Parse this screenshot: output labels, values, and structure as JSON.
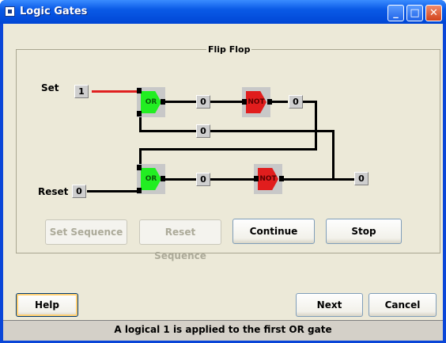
{
  "window": {
    "title": "Logic Gates",
    "minimize_glyph": "_",
    "maximize_glyph": "□",
    "close_glyph": "✕"
  },
  "frame": {
    "title": "Flip Flop"
  },
  "inputs": {
    "set_label": "Set",
    "set_value": "1",
    "reset_label": "Reset",
    "reset_value": "0"
  },
  "gates": {
    "or1": "OR",
    "not1": "NOT",
    "or2": "OR",
    "not2": "NOT"
  },
  "values": {
    "or1_out": "0",
    "not1_out": "0",
    "feedback": "0",
    "or2_out": "0",
    "output": "0"
  },
  "buttons": {
    "set_sequence": "Set Sequence",
    "reset_sequence": "Reset Sequence",
    "continue": "Continue",
    "stop": "Stop",
    "help": "Help",
    "next": "Next",
    "cancel": "Cancel"
  },
  "status": {
    "message": "A logical 1 is applied to the first OR gate"
  },
  "colors": {
    "title_bar": "#0a5ae6",
    "or_gate": "#22ee22",
    "not_gate": "#e11d1d",
    "active_wire": "#e02020"
  }
}
